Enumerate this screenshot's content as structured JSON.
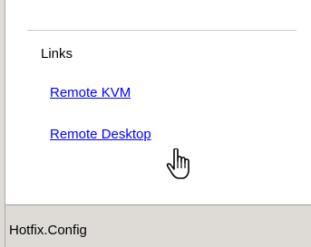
{
  "sidebar": {
    "links_heading": "Links",
    "links": [
      {
        "label": "Remote KVM"
      },
      {
        "label": "Remote Desktop"
      }
    ]
  },
  "status_bar": {
    "text": "Hotfix.Config"
  },
  "colors": {
    "link": "#0000ff",
    "panel_bg": "#ffffff",
    "status_bg": "#dedbd6"
  },
  "icons": {
    "cursor": "hand-pointer-icon"
  }
}
